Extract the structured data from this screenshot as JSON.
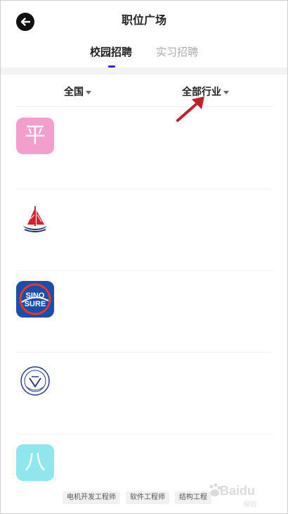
{
  "header": {
    "title": "职位广场",
    "back_icon": "arrow-left-icon"
  },
  "tabs": [
    {
      "label": "校园招聘",
      "active": true
    },
    {
      "label": "实习招聘",
      "active": false
    }
  ],
  "filters": {
    "region": "全国",
    "industry": "全部行业"
  },
  "colors": {
    "accent": "#2a2ad0",
    "annotation_arrow": "#c0202a",
    "logo1_bg": "#f29fcd",
    "logo3_bg": "#1a4ea8",
    "logo5_bg": "#8fe6ec"
  },
  "list": [
    {
      "logo_type": "text",
      "logo_text": "平",
      "logo_icon": "ping-logo-icon"
    },
    {
      "logo_type": "sailboat",
      "logo_icon": "sailboat-logo-icon"
    },
    {
      "logo_type": "sinosure",
      "logo_text": "SINO SURE",
      "logo_line1": "SINO",
      "logo_line2": "SURE",
      "logo_icon": "sinosure-logo-icon"
    },
    {
      "logo_type": "emblem",
      "logo_icon": "university-emblem-icon"
    },
    {
      "logo_type": "text",
      "logo_text": "八",
      "logo_icon": "ba-logo-icon"
    }
  ],
  "tags": [
    "电机开发工程师",
    "软件工程师",
    "结构工程"
  ],
  "watermark": {
    "text": "Baidu",
    "subtext": "经验",
    "icon": "baidu-paw-icon"
  }
}
